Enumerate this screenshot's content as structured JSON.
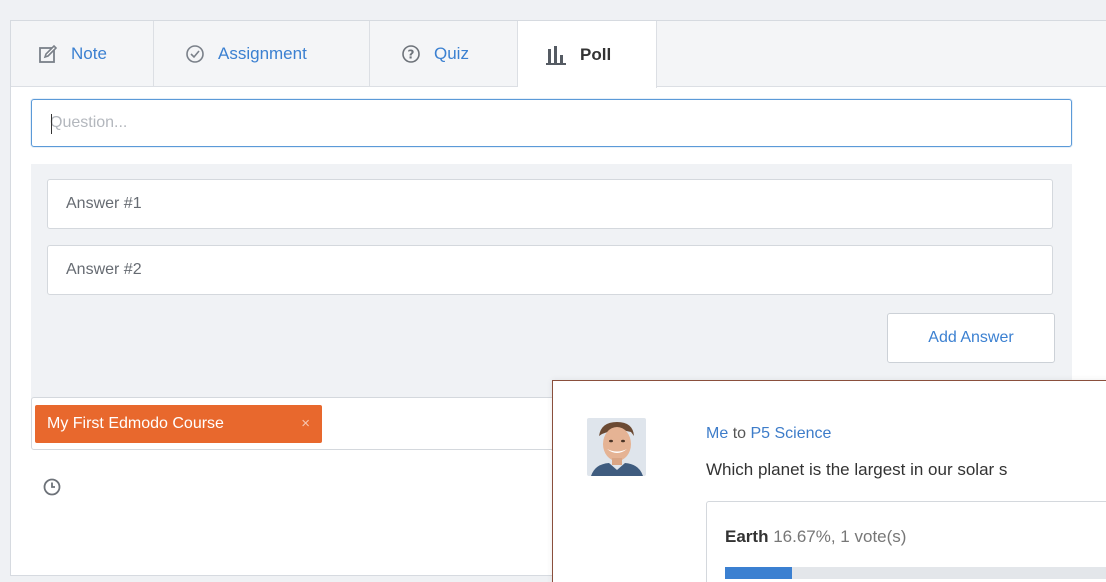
{
  "tabs": [
    {
      "label": "Note",
      "icon": "note-edit-icon"
    },
    {
      "label": "Assignment",
      "icon": "check-circle-icon"
    },
    {
      "label": "Quiz",
      "icon": "question-circle-icon"
    },
    {
      "label": "Poll",
      "icon": "bar-chart-icon",
      "active": true
    }
  ],
  "form": {
    "question_placeholder": "Question...",
    "answers": [
      {
        "placeholder": "Answer #1"
      },
      {
        "placeholder": "Answer #2"
      }
    ],
    "add_answer_label": "Add Answer",
    "recipient_chip": "My First Edmodo Course",
    "chip_remove": "×"
  },
  "post": {
    "author": "Me",
    "to_word": "to",
    "group": "P5 Science",
    "question": "Which planet is the largest in our solar s",
    "result": {
      "option": "Earth",
      "stats": "16.67%, 1 vote(s)",
      "percent": 16.67
    }
  },
  "colors": {
    "accent": "#3b80d1",
    "chip": "#e8682d",
    "popup_border": "#8a4f3c"
  }
}
